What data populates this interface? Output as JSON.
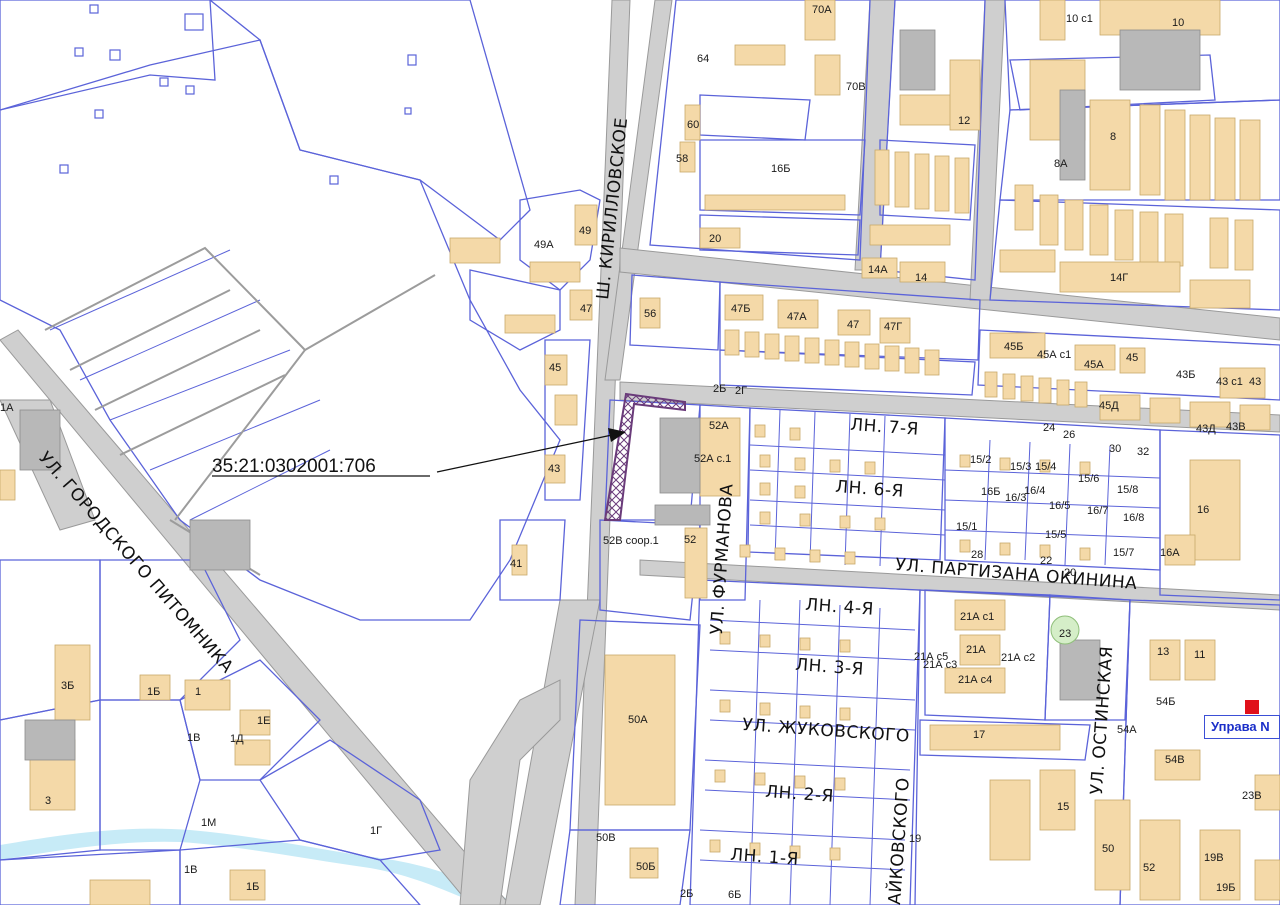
{
  "map": {
    "cadastral_number": "35:21:0302001:706",
    "poi_label": "Управа N",
    "colors": {
      "parcel_border": "#5b63d9",
      "building_fill": "#f4d9a8",
      "road_fill": "#c9c9c9",
      "highlight_parcel": "#6a3b7a",
      "river": "#bfe6f3",
      "poi_flag": "#e0101a"
    },
    "streets": {
      "kirillovskoe": "Ш. КИРИЛЛОВСКОЕ",
      "gorodskogo_pitomnika": "УЛ. ГОРОДСКОГО ПИТОМНИКА",
      "furmanova": "УЛ. ФУРМАНОВА",
      "partizana_okinina": "УЛ. ПАРТИЗАНА ОКИНИНА",
      "ostinskaya": "УЛ. ОСТИНСКАЯ",
      "zhukovskogo": "УЛ. ЖУКОВСКОГО",
      "chaykovskogo": "АЙКОВСКОГО",
      "ln7": "ЛН. 7-Я",
      "ln6": "ЛН. 6-Я",
      "ln4": "ЛН. 4-Я",
      "ln3": "ЛН. 3-Я",
      "ln2": "ЛН. 2-Я",
      "ln1": "ЛН. 1-Я"
    },
    "house_numbers": {
      "h70A": "70А",
      "h70B": "70В",
      "h64": "64",
      "h60": "60",
      "h58": "58",
      "h16B": "16Б",
      "h12a": "12",
      "h10c1": "10 с1",
      "h10": "10",
      "h8": "8",
      "h8A": "8А",
      "h49A": "49А",
      "h49": "49",
      "h20": "20",
      "h14A": "14А",
      "h14": "14",
      "h14G": "14Г",
      "h47": "47",
      "h56": "56",
      "h47B": "47Б",
      "h47A": "47А",
      "h47b": "47",
      "h47G": "47Г",
      "h45B": "45Б",
      "h45Ac1": "45А с1",
      "h45A": "45А",
      "h45": "45",
      "h43B": "43Б",
      "h43c1": "43 с1",
      "h43": "43",
      "h45D": "45Д",
      "h43D": "43Д",
      "h43V": "43В",
      "h45l": "45",
      "h43l": "43",
      "h41": "41",
      "h52A": "52А",
      "h52Ac1": "52А с.1",
      "h52": "52",
      "h52Vsoor": "52В соор.1",
      "h2B": "2Б",
      "h2G": "2Г",
      "h24": "24",
      "h26": "26",
      "h30": "30",
      "h32": "32",
      "h15_2": "15/2",
      "h15_3": "15/3",
      "h15_4": "15/4",
      "h15_6": "15/6",
      "h16B_": "16Б",
      "h16_3": "16/3",
      "h16_4": "16/4",
      "h16_5": "16/5",
      "h16_7": "16/7",
      "h15_8": "15/8",
      "h16_8": "16/8",
      "h15_1": "15/1",
      "h15_5": "15/5",
      "h15_7": "15/7",
      "h28": "28",
      "h22": "22",
      "h20b": "20",
      "h16": "16",
      "h16A": "16А",
      "h21Ac1": "21А с1",
      "h21A": "21А",
      "h21Ac5": "21А с5",
      "h21Ac3": "21А с3",
      "h21Ac2": "21А с2",
      "h21Ac4": "21А с4",
      "h23": "23",
      "h13": "13",
      "h11": "11",
      "h54B": "54Б",
      "h54A": "54А",
      "h54V": "54В",
      "h17": "17",
      "h15": "15",
      "h19": "19",
      "h50": "50",
      "h52b": "52",
      "h19B": "19В",
      "h19Bb": "19Б",
      "h23V": "23В",
      "h50A": "50А",
      "h50V": "50В",
      "h50B": "50Б",
      "h3B": "3Б",
      "h1B": "1Б",
      "h1": "1",
      "h1E": "1Е",
      "h1V": "1В",
      "h1D": "1Д",
      "h3": "3",
      "h1M": "1М",
      "h1G": "1Г",
      "h1Vb": "1В",
      "h1Bb": "1Б",
      "h1A": "1А",
      "h2Bb": "2Б",
      "h6B": "6Б"
    }
  }
}
